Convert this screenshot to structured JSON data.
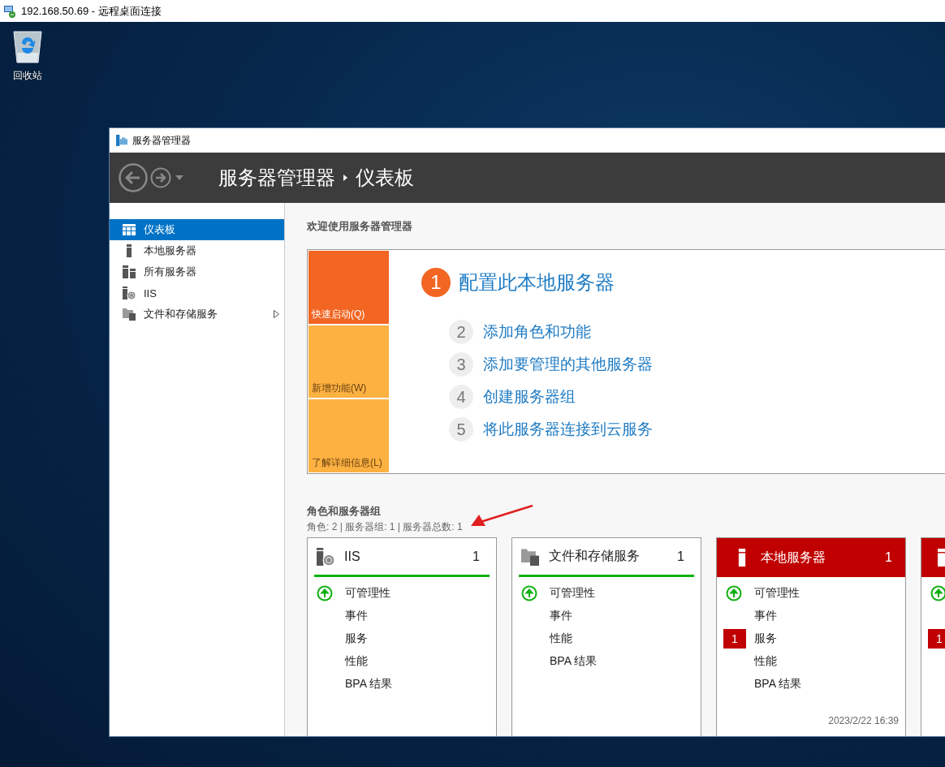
{
  "rdp_window": {
    "title": "192.168.50.69 - 远程桌面连接"
  },
  "desktop_icons": [
    {
      "label": "回收站"
    }
  ],
  "window": {
    "title": "服务器管理器"
  },
  "header": {
    "breadcrumb": [
      "服务器管理器",
      "仪表板"
    ]
  },
  "sidebar": {
    "items": [
      {
        "label": "仪表板",
        "kind": "dashboard",
        "selected": true,
        "expandable": false
      },
      {
        "label": "本地服务器",
        "kind": "server",
        "selected": false,
        "expandable": false
      },
      {
        "label": "所有服务器",
        "kind": "servers",
        "selected": false,
        "expandable": false
      },
      {
        "label": "IIS",
        "kind": "iis",
        "selected": false,
        "expandable": false
      },
      {
        "label": "文件和存储服务",
        "kind": "storage",
        "selected": false,
        "expandable": true
      }
    ]
  },
  "welcome": {
    "heading": "欢迎使用服务器管理器",
    "tiles": [
      {
        "label": "快速启动(Q)",
        "selected": true
      },
      {
        "label": "新增功能(W)",
        "selected": false
      },
      {
        "label": "了解详细信息(L)",
        "selected": false
      }
    ],
    "steps": [
      {
        "number": "1",
        "label": "配置此本地服务器",
        "selected": true
      },
      {
        "number": "2",
        "label": "添加角色和功能",
        "selected": false
      },
      {
        "number": "3",
        "label": "添加要管理的其他服务器",
        "selected": false
      },
      {
        "number": "4",
        "label": "创建服务器组",
        "selected": false
      },
      {
        "number": "5",
        "label": "将此服务器连接到云服务",
        "selected": false
      }
    ]
  },
  "roles": {
    "heading": "角色和服务器组",
    "summary": "角色: 2 | 服务器组: 1 | 服务器总数: 1",
    "cards": [
      {
        "kind": "iis",
        "title": "IIS",
        "count": "1",
        "alert": false,
        "rows": [
          {
            "label": "可管理性",
            "status_ok": true
          },
          {
            "label": "事件"
          },
          {
            "label": "服务"
          },
          {
            "label": "性能"
          },
          {
            "label": "BPA 结果"
          }
        ]
      },
      {
        "kind": "storage",
        "title": "文件和存储服务",
        "count": "1",
        "alert": false,
        "rows": [
          {
            "label": "可管理性",
            "status_ok": true
          },
          {
            "label": "事件"
          },
          {
            "label": "性能"
          },
          {
            "label": "BPA 结果"
          }
        ]
      },
      {
        "kind": "server",
        "title": "本地服务器",
        "count": "1",
        "alert": true,
        "rows": [
          {
            "label": "可管理性",
            "status_ok": true
          },
          {
            "label": "事件"
          },
          {
            "label": "服务",
            "alert_count": "1"
          },
          {
            "label": "性能"
          },
          {
            "label": "BPA 结果"
          }
        ],
        "timestamp": "2023/2/22 16:39"
      },
      {
        "kind": "servers",
        "alert": true,
        "rows": [
          {
            "status_ok": true
          },
          {},
          {
            "alert_count": "1"
          }
        ]
      }
    ]
  }
}
